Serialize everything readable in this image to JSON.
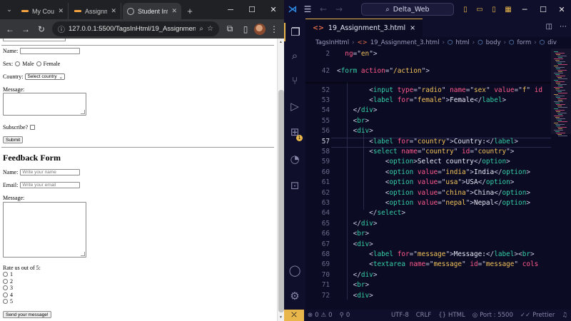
{
  "browser": {
    "tabs": [
      {
        "label": "My Course"
      },
      {
        "label": "Assignment"
      },
      {
        "label": "Student Information"
      }
    ],
    "new_tab": "+",
    "window_controls": {
      "minimize": "─",
      "maximize": "☐",
      "close": "✕"
    },
    "url": "127.0.0.1:5500/TagsInHtml/19_Assignment_3.html",
    "page": {
      "name_label": "Name:",
      "sex_label": "Sex:",
      "male_label": "Male",
      "female_label": "Female",
      "country_label": "Country:",
      "country_selected": "Select country",
      "message_label": "Message:",
      "subscribe_label": "Subscribe?",
      "submit_label": "Submit",
      "feedback_heading": "Feedback Form",
      "fb_name_label": "Name:",
      "fb_name_placeholder": "Write your name",
      "fb_email_label": "Email:",
      "fb_email_placeholder": "Write your email",
      "fb_message_label": "Message:",
      "rate_label": "Rate us out of 5:",
      "rate_options": [
        "1",
        "2",
        "3",
        "4",
        "5"
      ],
      "send_label": "Send your message!"
    }
  },
  "vscode": {
    "search_text": "Delta_Web",
    "tab_label": "19_Assignment_3.html",
    "tab_close": "×",
    "breadcrumbs": [
      "TagsInHtml",
      "19_Assignment_3.html",
      "html",
      "body",
      "form",
      "div"
    ],
    "extensions_badge": "1",
    "sticky": [
      {
        "n": "2",
        "segs": [
          [
            "tx",
            "  "
          ],
          [
            "at",
            "ng"
          ],
          [
            "pu",
            "=\""
          ],
          [
            "st",
            "en"
          ],
          [
            "pu",
            "\">"
          ]
        ]
      },
      {
        "n": "42",
        "segs": [
          [
            "pu",
            "<"
          ],
          [
            "tg",
            "form"
          ],
          [
            "at",
            " action"
          ],
          [
            "pu",
            "=\""
          ],
          [
            "st",
            "/action"
          ],
          [
            "pu",
            "\">"
          ]
        ]
      }
    ],
    "lines": [
      {
        "n": "51",
        "segs": [
          [
            "pu",
            "        <"
          ],
          [
            "tg",
            "label"
          ],
          [
            "at",
            " for"
          ],
          [
            "pu",
            "=\""
          ],
          [
            "st",
            "male"
          ],
          [
            "pu",
            "\">"
          ],
          [
            "tx",
            "Male"
          ],
          [
            "pu",
            "</"
          ],
          [
            "tg",
            "label"
          ],
          [
            "pu",
            ">"
          ]
        ]
      },
      {
        "n": "52",
        "segs": [
          [
            "pu",
            "        <"
          ],
          [
            "tg",
            "input"
          ],
          [
            "at",
            " type"
          ],
          [
            "pu",
            "=\""
          ],
          [
            "st",
            "radio"
          ],
          [
            "pu",
            "\""
          ],
          [
            "at",
            " name"
          ],
          [
            "pu",
            "=\""
          ],
          [
            "st",
            "sex"
          ],
          [
            "pu",
            "\""
          ],
          [
            "at",
            " value"
          ],
          [
            "pu",
            "=\""
          ],
          [
            "st",
            "f"
          ],
          [
            "pu",
            "\""
          ],
          [
            "at",
            " id"
          ]
        ]
      },
      {
        "n": "53",
        "segs": [
          [
            "pu",
            "        <"
          ],
          [
            "tg",
            "label"
          ],
          [
            "at",
            " for"
          ],
          [
            "pu",
            "=\""
          ],
          [
            "st",
            "female"
          ],
          [
            "pu",
            "\">"
          ],
          [
            "tx",
            "Female"
          ],
          [
            "pu",
            "</"
          ],
          [
            "tg",
            "label"
          ],
          [
            "pu",
            ">"
          ]
        ]
      },
      {
        "n": "54",
        "segs": [
          [
            "pu",
            "    </"
          ],
          [
            "tg",
            "div"
          ],
          [
            "pu",
            ">"
          ]
        ]
      },
      {
        "n": "55",
        "segs": [
          [
            "pu",
            "    <"
          ],
          [
            "tg",
            "br"
          ],
          [
            "pu",
            ">"
          ]
        ]
      },
      {
        "n": "56",
        "segs": [
          [
            "pu",
            "    <"
          ],
          [
            "tg",
            "div"
          ],
          [
            "pu",
            ">"
          ]
        ]
      },
      {
        "n": "57",
        "segs": [
          [
            "pu",
            "        <"
          ],
          [
            "tg",
            "label"
          ],
          [
            "at",
            " for"
          ],
          [
            "pu",
            "=\""
          ],
          [
            "st",
            "country"
          ],
          [
            "pu",
            "\">"
          ],
          [
            "tx",
            "Country:"
          ],
          [
            "pu",
            "</"
          ],
          [
            "tg",
            "label"
          ],
          [
            "pu",
            ">"
          ]
        ]
      },
      {
        "n": "58",
        "segs": [
          [
            "pu",
            "        <"
          ],
          [
            "tg",
            "select"
          ],
          [
            "at",
            " name"
          ],
          [
            "pu",
            "=\""
          ],
          [
            "st",
            "country"
          ],
          [
            "pu",
            "\""
          ],
          [
            "at",
            " id"
          ],
          [
            "pu",
            "=\""
          ],
          [
            "st",
            "country"
          ],
          [
            "pu",
            "\">"
          ]
        ]
      },
      {
        "n": "59",
        "segs": [
          [
            "pu",
            "            <"
          ],
          [
            "tg",
            "option"
          ],
          [
            "pu",
            ">"
          ],
          [
            "tx",
            "Select country"
          ],
          [
            "pu",
            "</"
          ],
          [
            "tg",
            "option"
          ],
          [
            "pu",
            ">"
          ]
        ]
      },
      {
        "n": "60",
        "segs": [
          [
            "pu",
            "            <"
          ],
          [
            "tg",
            "option"
          ],
          [
            "at",
            " value"
          ],
          [
            "pu",
            "=\""
          ],
          [
            "st",
            "india"
          ],
          [
            "pu",
            "\">"
          ],
          [
            "tx",
            "India"
          ],
          [
            "pu",
            "</"
          ],
          [
            "tg",
            "option"
          ],
          [
            "pu",
            ">"
          ]
        ]
      },
      {
        "n": "61",
        "segs": [
          [
            "pu",
            "            <"
          ],
          [
            "tg",
            "option"
          ],
          [
            "at",
            " value"
          ],
          [
            "pu",
            "=\""
          ],
          [
            "st",
            "usa"
          ],
          [
            "pu",
            "\">"
          ],
          [
            "tx",
            "USA"
          ],
          [
            "pu",
            "</"
          ],
          [
            "tg",
            "option"
          ],
          [
            "pu",
            ">"
          ]
        ]
      },
      {
        "n": "62",
        "segs": [
          [
            "pu",
            "            <"
          ],
          [
            "tg",
            "option"
          ],
          [
            "at",
            " value"
          ],
          [
            "pu",
            "=\""
          ],
          [
            "st",
            "china"
          ],
          [
            "pu",
            "\">"
          ],
          [
            "tx",
            "China"
          ],
          [
            "pu",
            "</"
          ],
          [
            "tg",
            "option"
          ],
          [
            "pu",
            ">"
          ]
        ]
      },
      {
        "n": "63",
        "segs": [
          [
            "pu",
            "            <"
          ],
          [
            "tg",
            "option"
          ],
          [
            "at",
            " value"
          ],
          [
            "pu",
            "=\""
          ],
          [
            "st",
            "nepal"
          ],
          [
            "pu",
            "\">"
          ],
          [
            "tx",
            "Nepal"
          ],
          [
            "pu",
            "</"
          ],
          [
            "tg",
            "option"
          ],
          [
            "pu",
            ">"
          ]
        ]
      },
      {
        "n": "64",
        "segs": [
          [
            "pu",
            "        </"
          ],
          [
            "tg",
            "select"
          ],
          [
            "pu",
            ">"
          ]
        ]
      },
      {
        "n": "65",
        "segs": [
          [
            "pu",
            "    </"
          ],
          [
            "tg",
            "div"
          ],
          [
            "pu",
            ">"
          ]
        ]
      },
      {
        "n": "66",
        "segs": [
          [
            "pu",
            "    <"
          ],
          [
            "tg",
            "br"
          ],
          [
            "pu",
            ">"
          ]
        ]
      },
      {
        "n": "67",
        "segs": [
          [
            "pu",
            "    <"
          ],
          [
            "tg",
            "div"
          ],
          [
            "pu",
            ">"
          ]
        ]
      },
      {
        "n": "68",
        "segs": [
          [
            "pu",
            "        <"
          ],
          [
            "tg",
            "label"
          ],
          [
            "at",
            " for"
          ],
          [
            "pu",
            "=\""
          ],
          [
            "st",
            "message"
          ],
          [
            "pu",
            "\">"
          ],
          [
            "tx",
            "Message:"
          ],
          [
            "pu",
            "</"
          ],
          [
            "tg",
            "label"
          ],
          [
            "pu",
            "><"
          ],
          [
            "tg",
            "br"
          ],
          [
            "pu",
            ">"
          ]
        ]
      },
      {
        "n": "69",
        "segs": [
          [
            "pu",
            "        <"
          ],
          [
            "tg",
            "textarea"
          ],
          [
            "at",
            " name"
          ],
          [
            "pu",
            "=\""
          ],
          [
            "st",
            "message"
          ],
          [
            "pu",
            "\""
          ],
          [
            "at",
            " id"
          ],
          [
            "pu",
            "=\""
          ],
          [
            "st",
            "message"
          ],
          [
            "pu",
            "\""
          ],
          [
            "at",
            " cols"
          ]
        ]
      },
      {
        "n": "70",
        "segs": [
          [
            "pu",
            "    </"
          ],
          [
            "tg",
            "div"
          ],
          [
            "pu",
            ">"
          ]
        ]
      },
      {
        "n": "71",
        "segs": [
          [
            "pu",
            "    <"
          ],
          [
            "tg",
            "br"
          ],
          [
            "pu",
            ">"
          ]
        ]
      },
      {
        "n": "72",
        "segs": [
          [
            "pu",
            "    <"
          ],
          [
            "tg",
            "div"
          ],
          [
            "pu",
            ">"
          ]
        ]
      }
    ],
    "current_line": "57",
    "status": {
      "errors": "0",
      "warnings": "0",
      "ports": "0",
      "encoding": "UTF-8",
      "eol": "CRLF",
      "language": "HTML",
      "port": "Port : 5500",
      "prettier": "Prettier"
    },
    "colors": {
      "accent": "#e8b64a",
      "tag": "#35d0a6",
      "attr": "#ff5a8a",
      "string": "#f2c35a"
    }
  }
}
